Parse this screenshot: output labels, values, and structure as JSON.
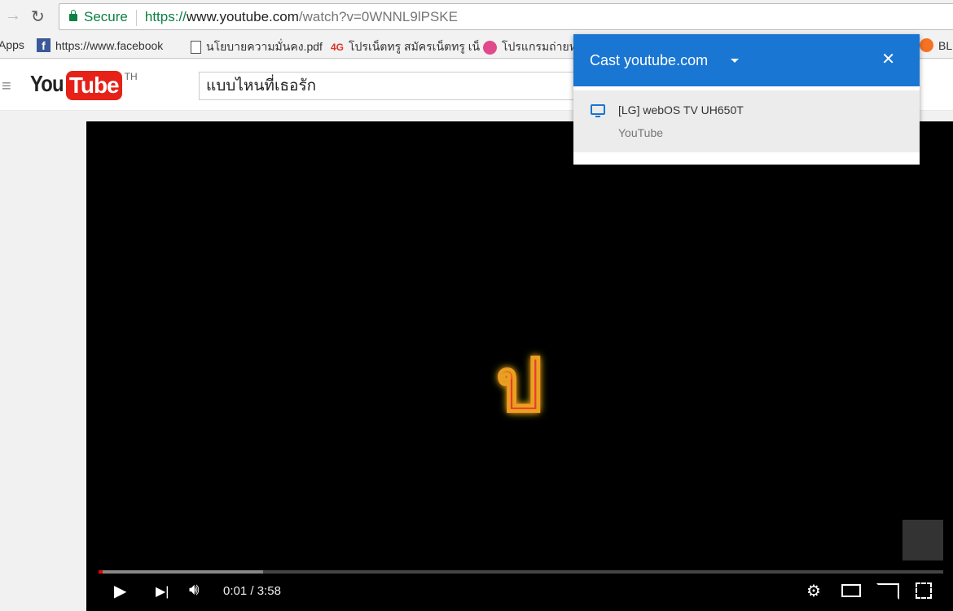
{
  "browser": {
    "secure_label": "Secure",
    "url_scheme": "https://",
    "url_host": "www.youtube.com",
    "url_path": "/watch?v=0WNNL9lPSKE"
  },
  "bookmarks": [
    {
      "label": "Apps"
    },
    {
      "label": "https://www.facebook"
    },
    {
      "label": "นโยบายความมั่นคง.pdf"
    },
    {
      "label": "โปรเน็ตทรู สมัครเน็ตทรู เน็"
    },
    {
      "label": "โปรแกรมถ่ายห"
    },
    {
      "label": "BL"
    }
  ],
  "youtube": {
    "logo_you": "You",
    "logo_tube": "Tube",
    "country": "TH",
    "search_value": "แบบไหนที่เธอรัก"
  },
  "player": {
    "current_time": "0:01",
    "duration": "3:58",
    "time_sep": " / ",
    "played_percent": 0.4,
    "buffered_percent": 19.5
  },
  "cast": {
    "title": "Cast youtube.com",
    "device_name": "[LG] webOS TV UH650T",
    "device_app": "YouTube",
    "accent": "#1976d2"
  }
}
